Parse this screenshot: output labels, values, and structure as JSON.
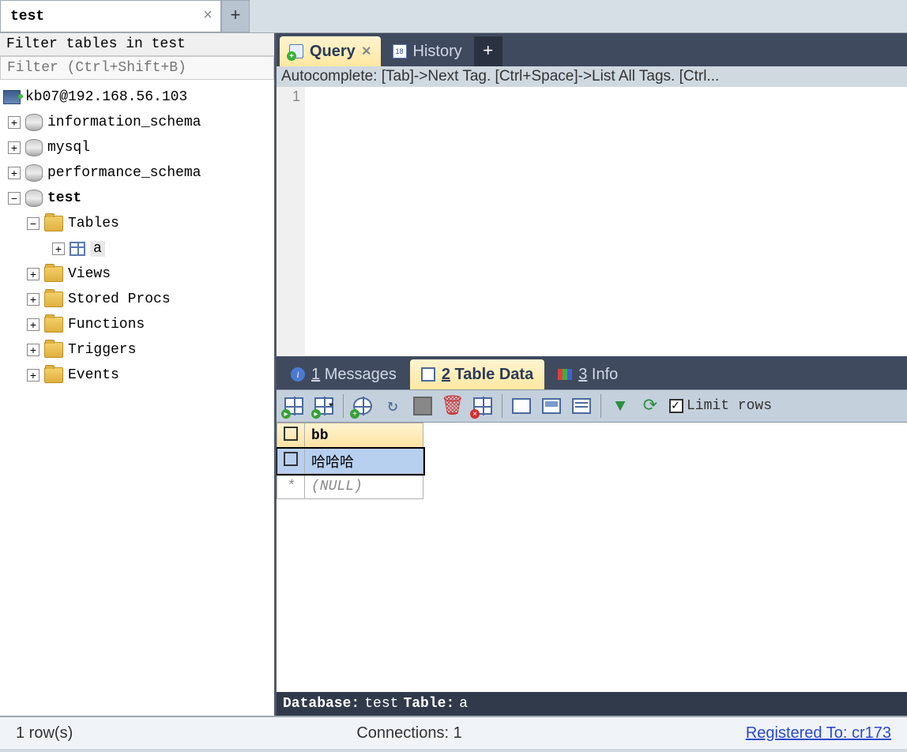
{
  "top_tab": {
    "label": "test"
  },
  "sidebar": {
    "filter_label": "Filter tables in test",
    "filter_placeholder": "Filter (Ctrl+Shift+B)",
    "server": "kb07@192.168.56.103",
    "dbs": [
      "information_schema",
      "mysql",
      "performance_schema",
      "test"
    ],
    "folders": [
      "Tables",
      "Views",
      "Stored Procs",
      "Functions",
      "Triggers",
      "Events"
    ],
    "table": "a"
  },
  "query_tabs": {
    "query": "Query",
    "history": "History",
    "history_day": "18"
  },
  "hint": "Autocomplete: [Tab]->Next Tag. [Ctrl+Space]->List All Tags. [Ctrl...",
  "line_num": "1",
  "result_tabs": {
    "messages": "Messages",
    "tabledata": "Table Data",
    "info": "Info",
    "n1": "1",
    "n2": "2",
    "n3": "3"
  },
  "toolbar": {
    "limit_label": "Limit rows"
  },
  "grid": {
    "col": "bb",
    "rows": [
      "哈哈哈"
    ],
    "null": "(NULL)"
  },
  "status_db": {
    "db_lbl": "Database:",
    "db": "test",
    "tbl_lbl": "Table:",
    "tbl": "a"
  },
  "status": {
    "rows": "1 row(s)",
    "conn": "Connections: 1",
    "reg": "Registered To: cr173"
  }
}
